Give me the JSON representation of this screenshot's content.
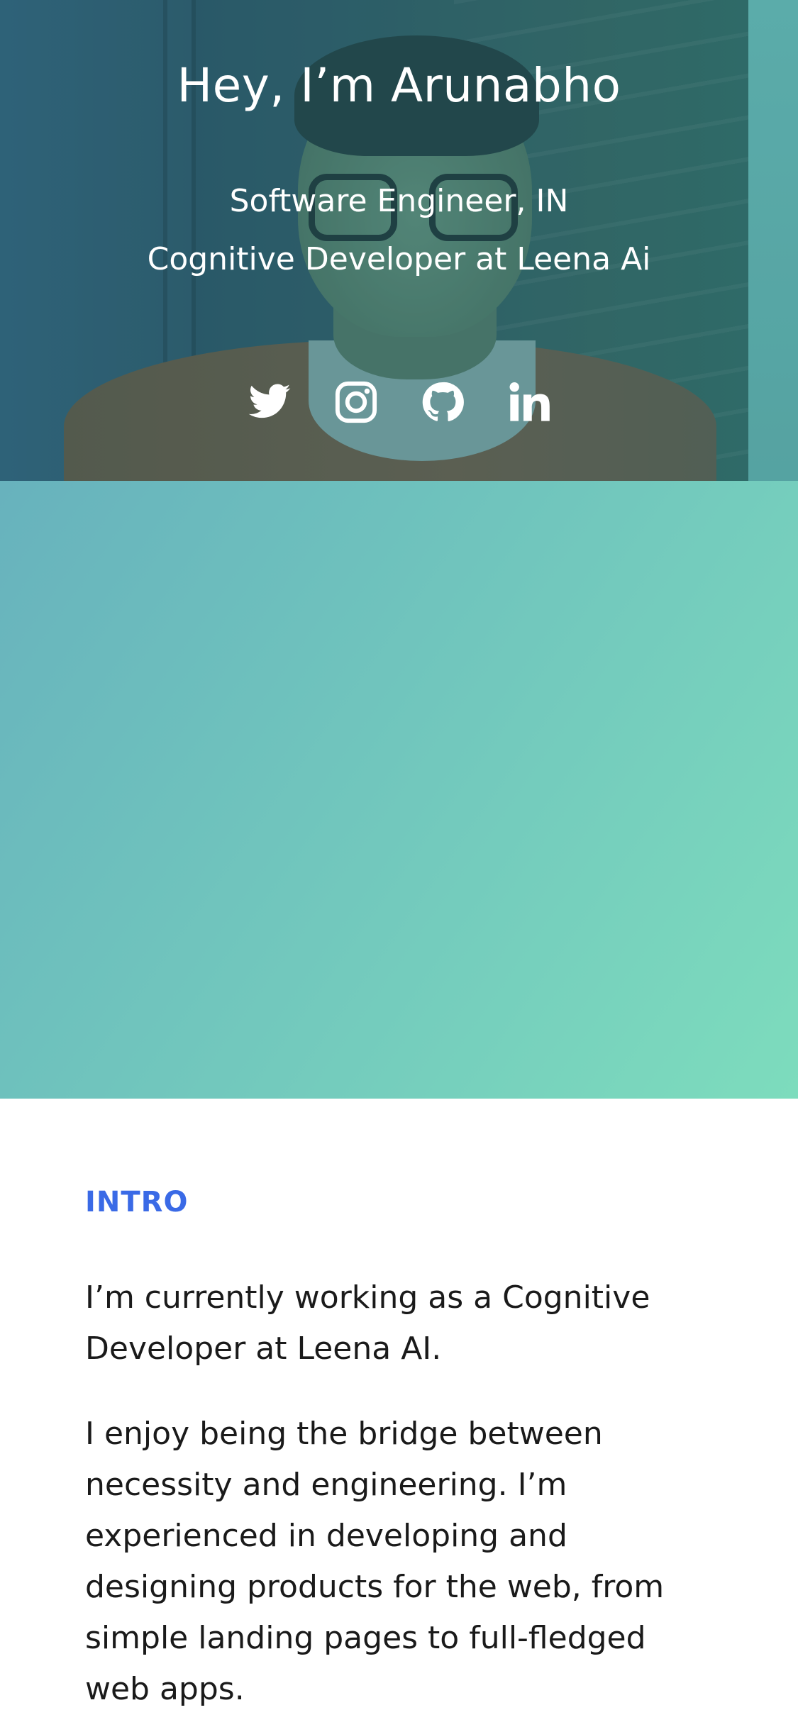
{
  "hero": {
    "title": "Hey, I’m Arunabho",
    "subtitle_line1": "Software Engineer, IN",
    "subtitle_line2": "Cognitive Developer at Leena Ai",
    "gradient_colors": [
      "#63a6bd",
      "#7ddcbd"
    ],
    "social_icons": [
      {
        "name": "twitter-icon",
        "label": "Twitter"
      },
      {
        "name": "instagram-icon",
        "label": "Instagram"
      },
      {
        "name": "github-icon",
        "label": "GitHub"
      },
      {
        "name": "linkedin-icon",
        "label": "LinkedIn"
      }
    ]
  },
  "intro": {
    "heading": "INTRO",
    "heading_color": "#3a6ae6",
    "paragraph1": "I’m currently working as a Cognitive Developer at Leena AI.",
    "paragraph2": "I enjoy being the bridge between necessity and engineering. I’m experienced in developing and designing products for the web, from simple landing pages to full-fledged web apps."
  }
}
